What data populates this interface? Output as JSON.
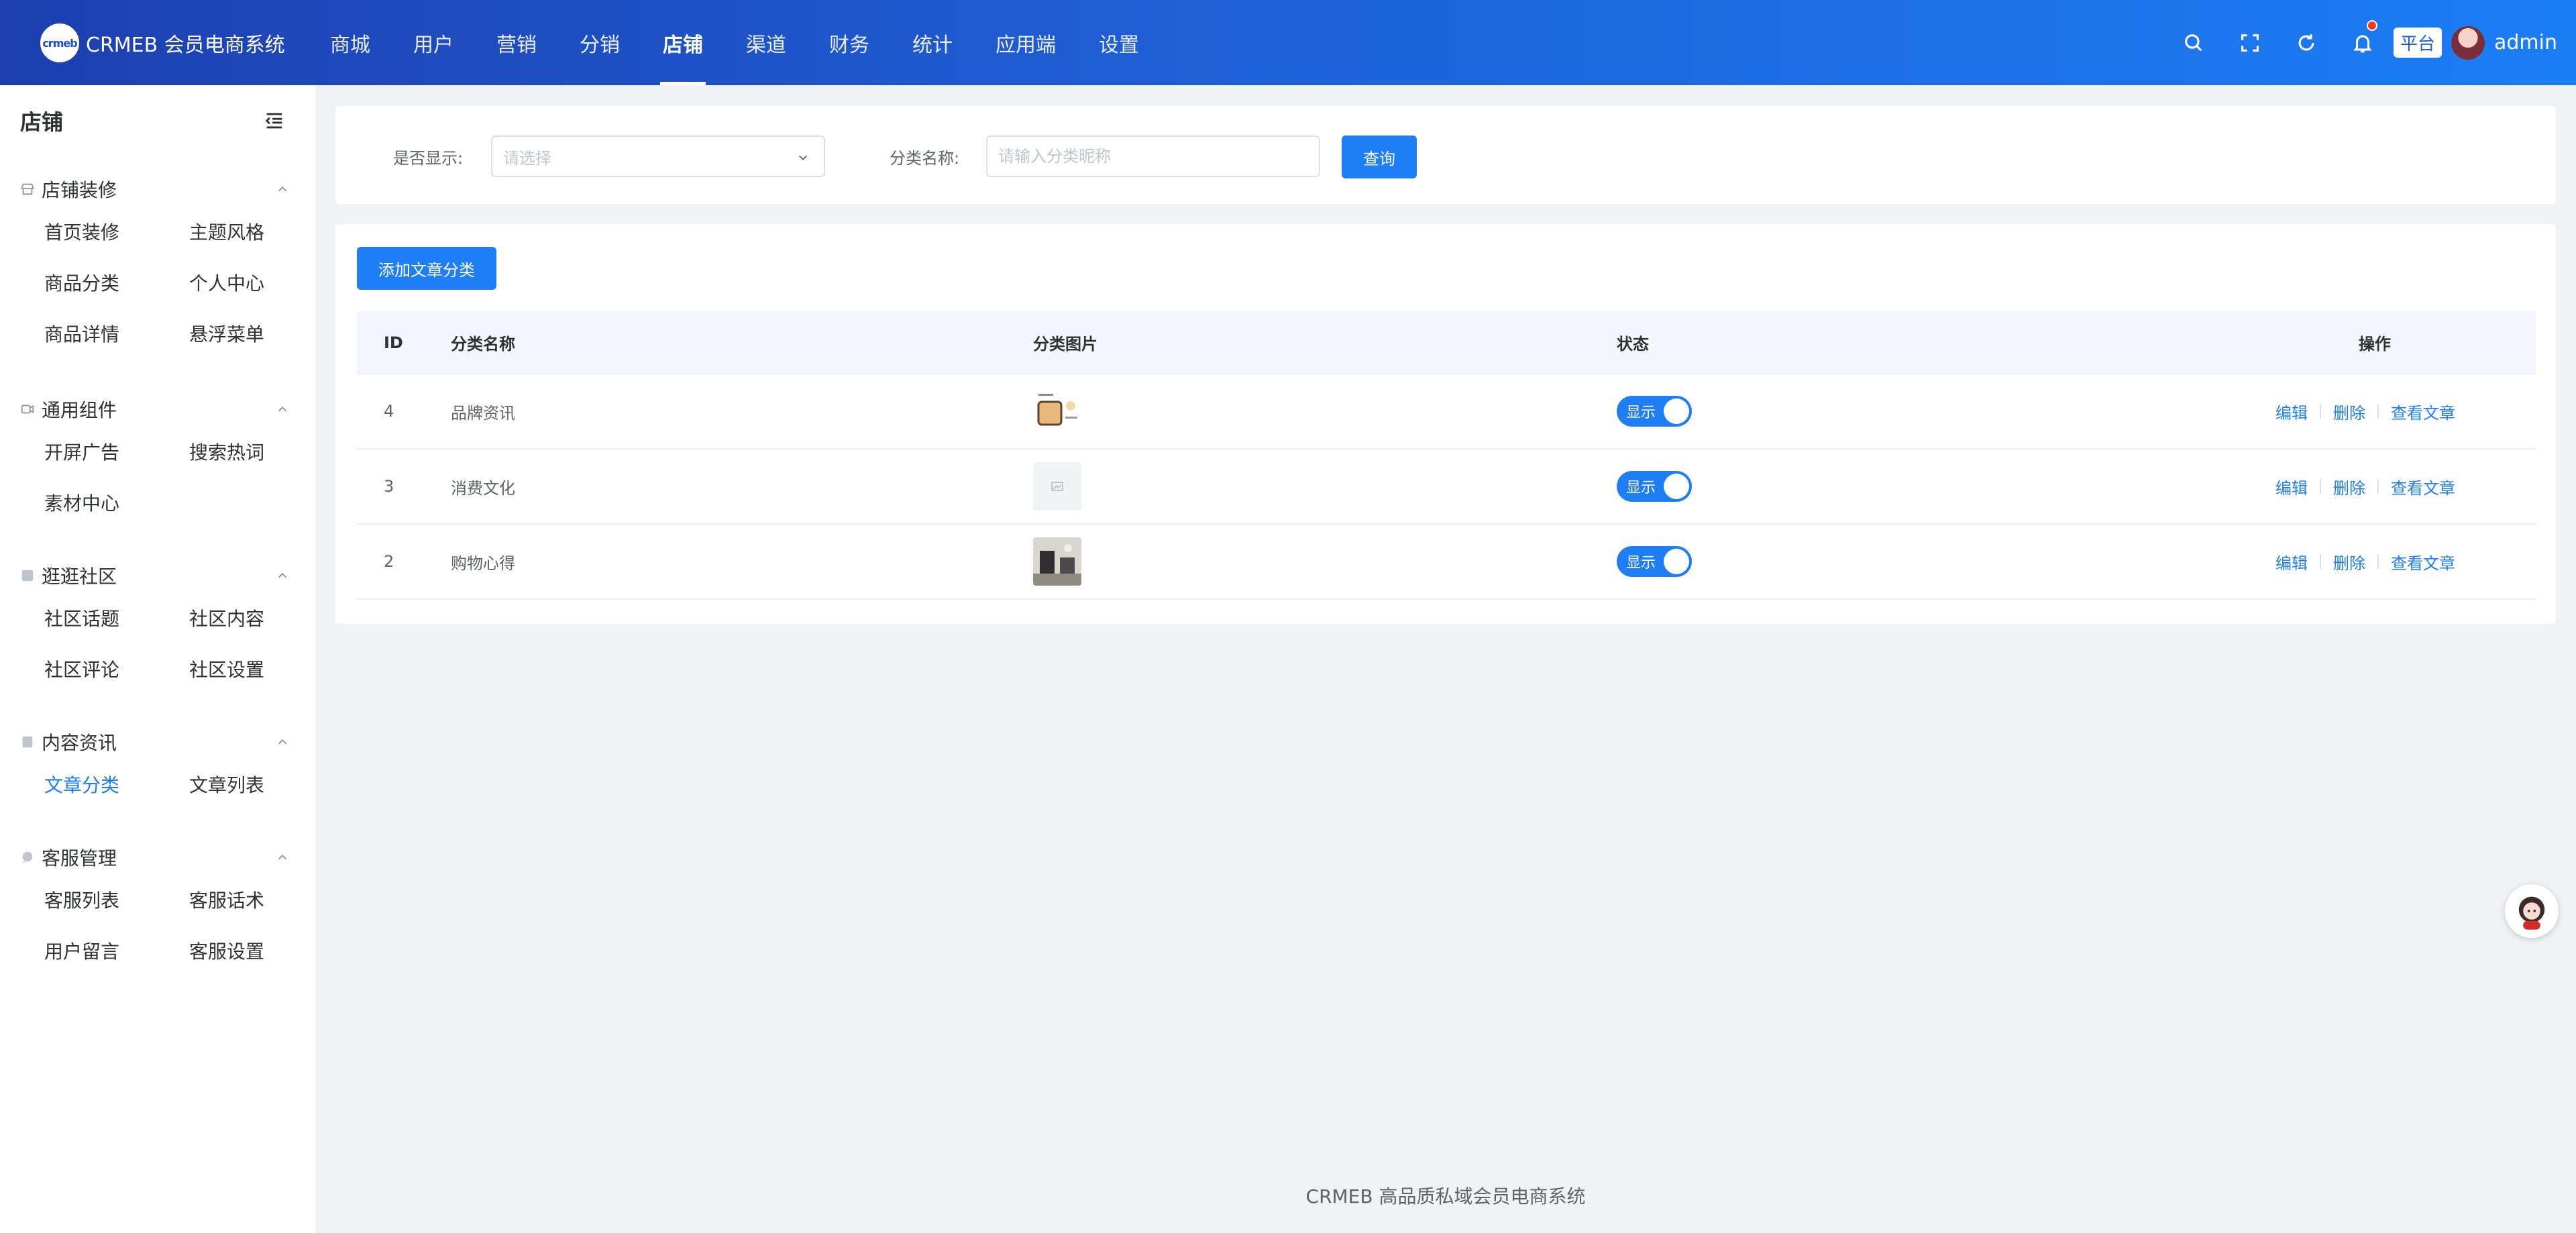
{
  "header": {
    "logo_badge": "crmeb",
    "logo_text": "CRMEB 会员电商系统",
    "nav": [
      "商城",
      "用户",
      "营销",
      "分销",
      "店铺",
      "渠道",
      "财务",
      "统计",
      "应用端",
      "设置"
    ],
    "active_nav_index": 4,
    "platform_label": "平台",
    "user_name": "admin",
    "tool_icons": [
      "search-icon",
      "fullscreen-icon",
      "refresh-icon",
      "bell-icon"
    ]
  },
  "sidebar": {
    "title": "店铺",
    "groups": [
      {
        "title": "店铺装修",
        "icon": "store-icon",
        "items": [
          "首页装修",
          "主题风格",
          "商品分类",
          "个人中心",
          "商品详情",
          "悬浮菜单"
        ]
      },
      {
        "title": "通用组件",
        "icon": "component-icon",
        "items": [
          "开屏广告",
          "搜索热词",
          "素材中心"
        ]
      },
      {
        "title": "逛逛社区",
        "icon": "community-icon",
        "items": [
          "社区话题",
          "社区内容",
          "社区评论",
          "社区设置"
        ]
      },
      {
        "title": "内容资讯",
        "icon": "article-icon",
        "items": [
          "文章分类",
          "文章列表"
        ]
      },
      {
        "title": "客服管理",
        "icon": "service-icon",
        "items": [
          "客服列表",
          "客服话术",
          "用户留言",
          "客服设置"
        ]
      }
    ],
    "active_item": "文章分类"
  },
  "filter": {
    "show_label": "是否显示:",
    "show_placeholder": "请选择",
    "name_label": "分类名称:",
    "name_placeholder": "请输入分类昵称",
    "query_button": "查询"
  },
  "list": {
    "add_button": "添加文章分类",
    "columns": [
      "ID",
      "分类名称",
      "分类图片",
      "状态",
      "操作"
    ],
    "rows": [
      {
        "id": "4",
        "name": "品牌资讯",
        "status": "显示",
        "actions": [
          "编辑",
          "删除",
          "查看文章"
        ]
      },
      {
        "id": "3",
        "name": "消费文化",
        "status": "显示",
        "actions": [
          "编辑",
          "删除",
          "查看文章"
        ]
      },
      {
        "id": "2",
        "name": "购物心得",
        "status": "显示",
        "actions": [
          "编辑",
          "删除",
          "查看文章"
        ]
      }
    ]
  },
  "footer": {
    "text": "CRMEB 高品质私域会员电商系统"
  },
  "colors": {
    "primary": "#1d7ef5",
    "header_start": "#1d3fb0",
    "header_end": "#1c7ef5",
    "badge": "#f5362a"
  }
}
